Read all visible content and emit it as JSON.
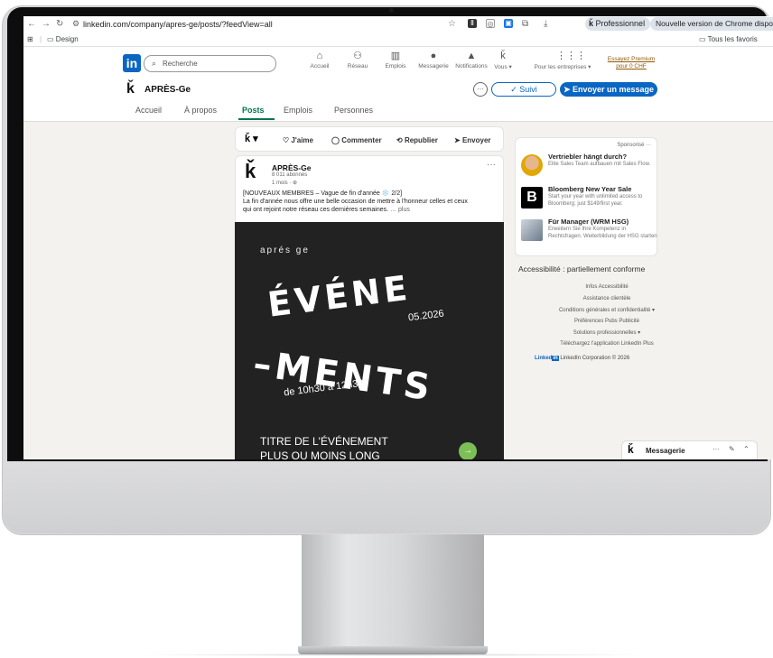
{
  "browser": {
    "url_text": "linkedin.com/company/apres-ge/posts/?feedView=all",
    "bookmark_folder": "Design",
    "all_bookmarks": "Tous les favoris",
    "profile_label": "Professionnel",
    "update_label": "Nouvelle version de Chrome disponible"
  },
  "nav": {
    "search_placeholder": "Recherche",
    "items": [
      "Accueil",
      "Réseau",
      "Emplois",
      "Messagerie",
      "Notifications",
      "Vous ▾",
      "Pour les entreprises ▾"
    ],
    "premium_line1": "Essayez Premium",
    "premium_line2": "pour 0 CHF"
  },
  "company": {
    "name": "APRÈS-Ge",
    "following_label": "✓ Suivi",
    "message_label": "Envoyer un message",
    "tabs": [
      "Accueil",
      "À propos",
      "Posts",
      "Emplois",
      "Personnes"
    ]
  },
  "actions": {
    "like": "J'aime",
    "comment": "Commenter",
    "repost": "Republier",
    "send": "Envoyer"
  },
  "post": {
    "author": "APRÈS-Ge",
    "followers": "8 011 abonnés",
    "time": "1 mois · ",
    "line1": "[NOUVEAUX MEMBRES – Vague de fin d'année ❄️ 2/2]",
    "line2": "La fin d'année nous offre une belle occasion de mettre à l'honneur celles et ceux",
    "line3": "qui ont rejoint notre réseau ces dernières semaines.",
    "more": "… plus",
    "image": {
      "brand": "aprés ge",
      "word1": "ÉVÉNE",
      "date": "05.2026",
      "word2": "–MENTS",
      "hours": "de 10h30 à 12h30",
      "title1": "TITRE DE L'ÉVÉNEMENT",
      "title2": "PLUS OU MOINS LONG"
    }
  },
  "ads": {
    "sponsored": "Sponsorisé ···",
    "items": [
      {
        "title": "Vertriebler hängt durch?",
        "desc": "Elite Sales Team aufbauen mit Sales Flow."
      },
      {
        "title": "Bloomberg New Year Sale",
        "desc": "Start your year with unlimited access to Bloomberg; just $149/first year."
      },
      {
        "title": "Für Manager (WRM HSG)",
        "desc": "Erweitern Sie Ihre Kompetenz in Rechtsfragen. Weiterbildung der HSG starten"
      }
    ]
  },
  "footer": {
    "accessibility": "Accessibilité : partiellement conforme",
    "links": [
      "Infos   Accessibilité",
      "Assistance clientèle",
      "Conditions générales et confidentialité ▾",
      "Préférences Pubs   Publicité",
      "Solutions professionnelles ▾",
      "Téléchargez l'application LinkedIn   Plus"
    ],
    "brand_word": "Linked",
    "brand_in": "in",
    "copyright": "LinkedIn Corporation © 2026"
  },
  "messaging": {
    "label": "Messagerie",
    "more": "···"
  },
  "colors": {
    "linkedin_blue": "#0a66c2",
    "active_tab_green": "#01754f",
    "page_bg": "#f4f2ee"
  }
}
